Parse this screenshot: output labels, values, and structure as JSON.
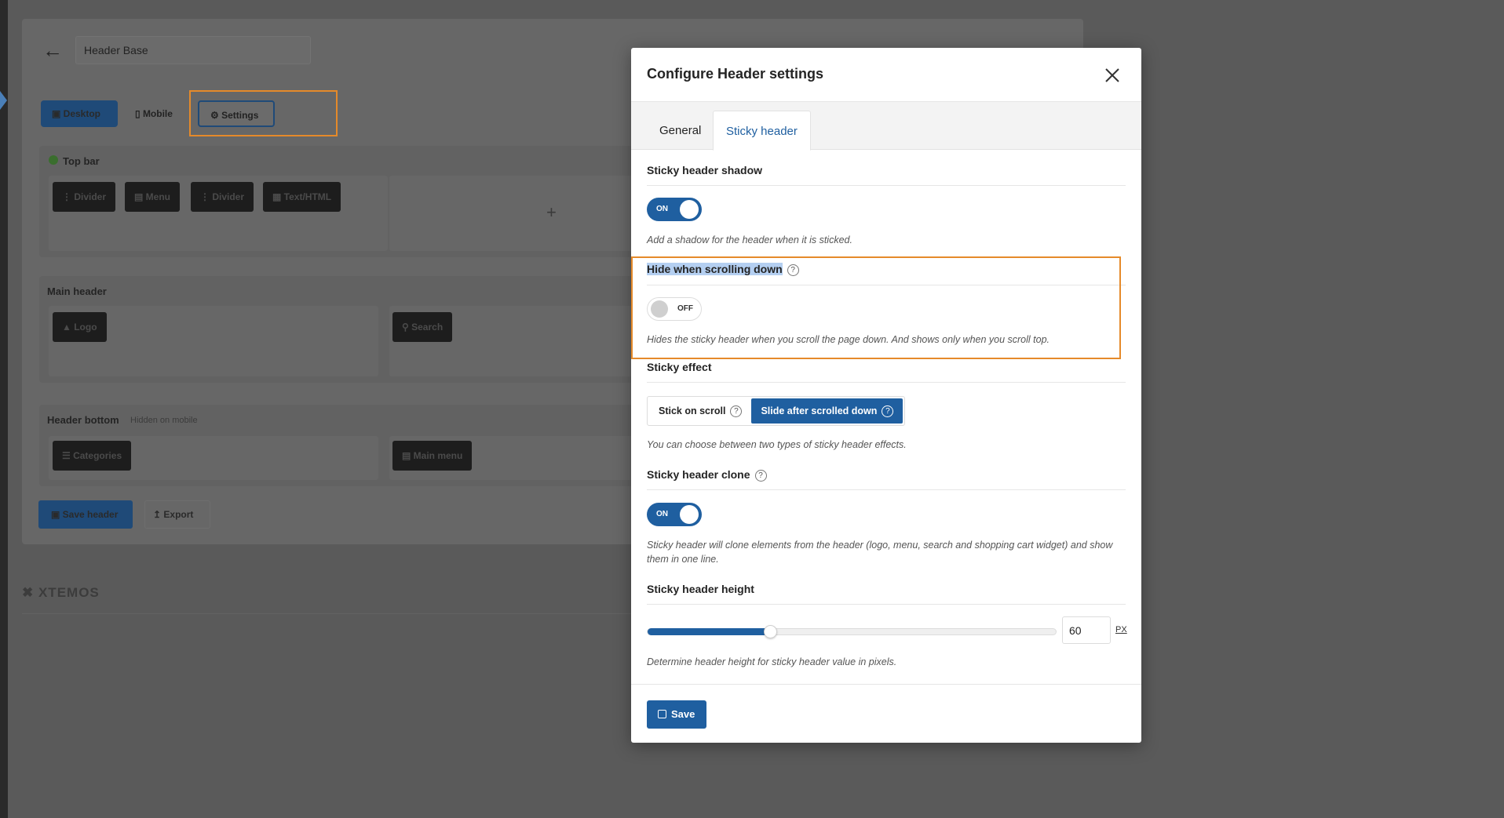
{
  "background": {
    "header_name": "Header Base",
    "tabs": {
      "desktop": "Desktop",
      "mobile": "Mobile",
      "settings": "Settings"
    },
    "top_bar": {
      "label": "Top bar",
      "chips": [
        "Divider",
        "Menu",
        "Divider",
        "Text/HTML"
      ]
    },
    "main_header": {
      "label": "Main header",
      "chips": [
        "Logo",
        "Search"
      ]
    },
    "header_bottom": {
      "label": "Header bottom",
      "hint": "Hidden on mobile",
      "chips": [
        "Categories",
        "Main menu"
      ]
    },
    "save_header": "Save header",
    "export": "Export",
    "logo_text": "XTEMOS"
  },
  "modal": {
    "title": "Configure Header settings",
    "tabs": {
      "general": "General",
      "sticky": "Sticky header"
    },
    "shadow": {
      "title": "Sticky header shadow",
      "state": "ON",
      "description": "Add a shadow for the header when it is sticked."
    },
    "hide_scroll": {
      "title": "Hide when scrolling down",
      "state": "OFF",
      "description": "Hides the sticky header when you scroll the page down. And shows only when you scroll top."
    },
    "effect": {
      "title": "Sticky effect",
      "options": [
        "Stick on scroll",
        "Slide after scrolled down"
      ],
      "selected": "Slide after scrolled down",
      "description": "You can choose between two types of sticky header effects."
    },
    "clone": {
      "title": "Sticky header clone",
      "state": "ON",
      "description": "Sticky header will clone elements from the header (logo, menu, search and shopping cart widget) and show them in one line."
    },
    "height": {
      "title": "Sticky header height",
      "value": "60",
      "fill_fraction": 0.3,
      "unit": "PX",
      "description": "Determine header height for sticky header value in pixels."
    },
    "save_label": "Save"
  },
  "colors": {
    "accent": "#1f5fa0",
    "highlight": "#e58a2a",
    "selection": "#b4cff1"
  }
}
